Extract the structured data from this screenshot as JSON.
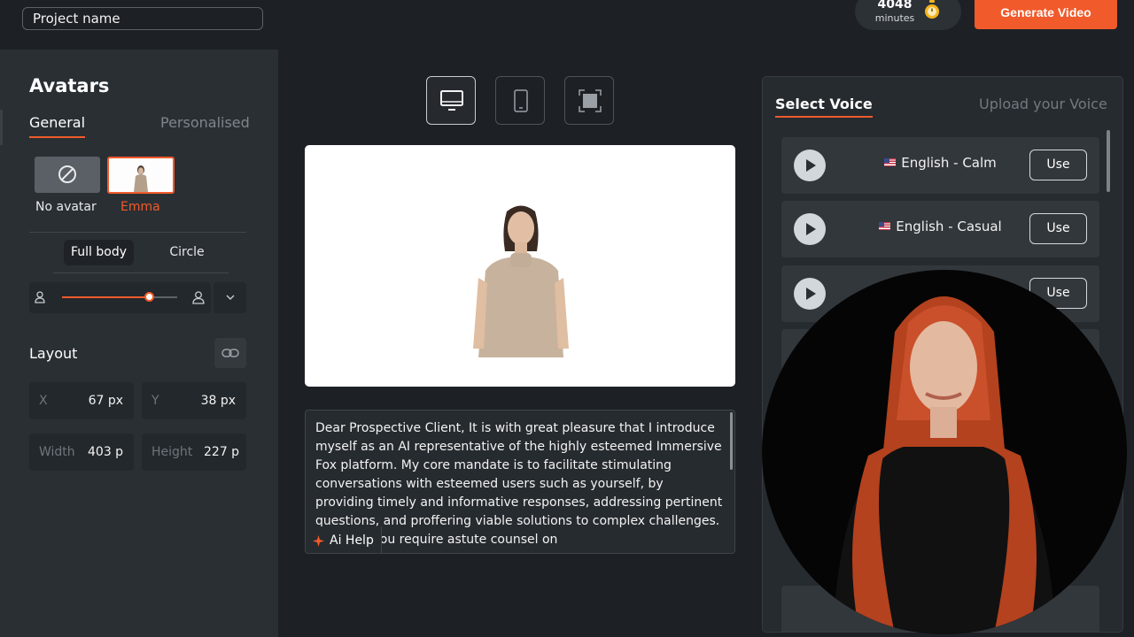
{
  "header": {
    "project_name": "Project name",
    "minutes_value": "4048",
    "minutes_unit": "minutes",
    "generate_label": "Generate Video"
  },
  "avatars": {
    "title": "Avatars",
    "tab_general": "General",
    "tab_personalised": "Personalised",
    "no_avatar_label": "No avatar",
    "emma_label": "Emma",
    "shape_full_body": "Full body",
    "shape_circle": "Circle",
    "size_slider_fraction": 0.75
  },
  "layout": {
    "title": "Layout",
    "x_label": "X",
    "x_value": "67 px",
    "y_label": "Y",
    "y_value": "38 px",
    "width_label": "Width",
    "width_value": "403 p",
    "height_label": "Height",
    "height_value": "227 p"
  },
  "editor": {
    "script": "Dear Prospective Client, It is with great pleasure that I introduce myself as an AI representative of the highly esteemed Immersive Fox platform. My core mandate is to facilitate stimulating conversations with esteemed users such as yourself, by providing timely and informative responses, addressing pertinent questions, and proffering viable solutions to complex challenges. Whether you require astute counsel on",
    "ai_help_label": "Ai Help"
  },
  "voices": {
    "tab_select": "Select Voice",
    "tab_upload": "Upload your Voice",
    "use_label": "Use",
    "items": [
      {
        "name": "English - Calm"
      },
      {
        "name": "English - Casual"
      }
    ]
  },
  "colors": {
    "accent": "#f15a2b",
    "background": "#1d2125",
    "panel": "#2a2f34"
  }
}
